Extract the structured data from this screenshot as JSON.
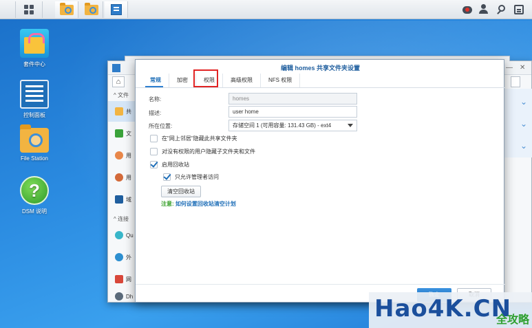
{
  "desktop": {
    "icons": [
      {
        "label": "套件中心"
      },
      {
        "label": "控制面板"
      },
      {
        "label": "File Station"
      },
      {
        "label": "DSM 说明"
      }
    ]
  },
  "back_window": {
    "side_heads": [
      "文件",
      "连接"
    ],
    "side_items": [
      "共",
      "文",
      "用",
      "用",
      "域",
      "Qu",
      "外",
      "网",
      "Dh"
    ]
  },
  "dialog": {
    "title": "编辑 homes 共享文件夹设置",
    "tabs": [
      "常规",
      "加密",
      "权限",
      "高级权限",
      "NFS 权限"
    ],
    "fields": {
      "name_label": "名称:",
      "name_value": "homes",
      "desc_label": "描述:",
      "desc_value": "user home",
      "location_label": "所在位置:",
      "location_value": "存储空间 1 (可用容量:  131.43 GB) - ext4"
    },
    "checkboxes": {
      "hide_network": {
        "label": "在\"网上邻居\"隐藏此共享文件夹",
        "checked": false
      },
      "hide_subfolders": {
        "label": "对没有权限的用户隐藏子文件夹和文件",
        "checked": false
      },
      "recycle_bin": {
        "label": "启用回收站",
        "checked": true
      },
      "admin_only": {
        "label": "只允许管理者访问",
        "checked": true
      }
    },
    "clear_button": "清空回收站",
    "note_prefix": "注意:",
    "note_link": "如何设置回收站清空计划",
    "ok_button": "确定",
    "cancel_button": "取消"
  },
  "watermark": {
    "text": "Hao4K.CN",
    "sub": "全攻略"
  }
}
